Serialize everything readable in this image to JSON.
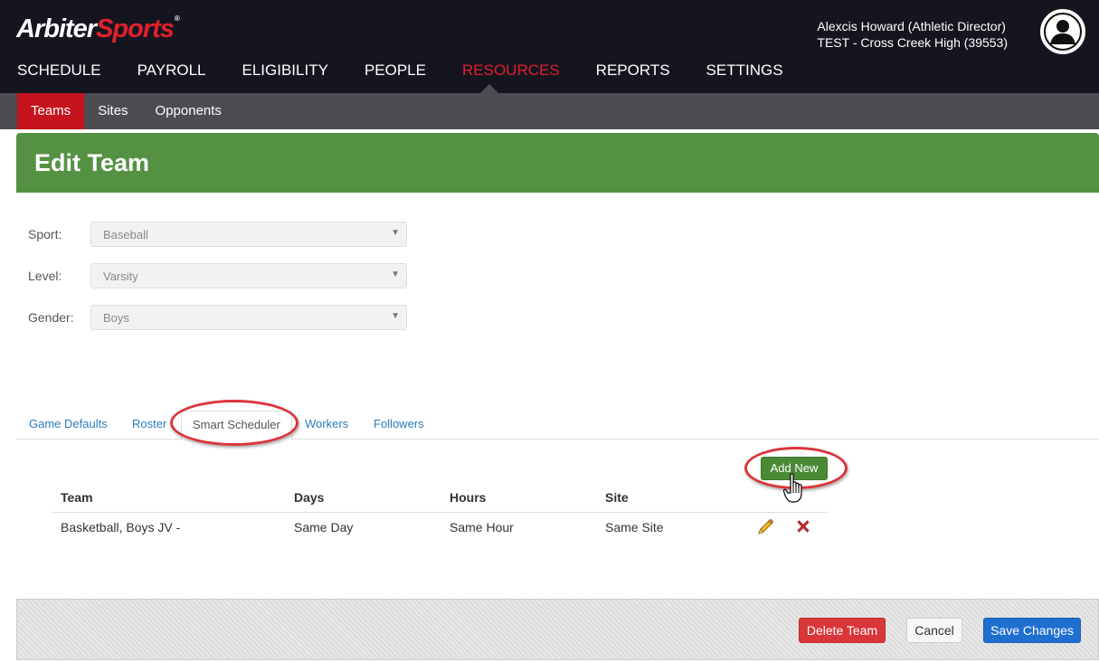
{
  "brand": {
    "part1": "Arbiter",
    "part2": "Sports"
  },
  "user": {
    "name": "Alexcis Howard (Athletic Director)",
    "org": "TEST - Cross Creek High (39553)"
  },
  "main_nav": [
    "SCHEDULE",
    "PAYROLL",
    "ELIGIBILITY",
    "PEOPLE",
    "RESOURCES",
    "REPORTS",
    "SETTINGS"
  ],
  "main_nav_active": "RESOURCES",
  "sub_nav": [
    "Teams",
    "Sites",
    "Opponents"
  ],
  "sub_nav_active": "Teams",
  "page_title": "Edit Team",
  "form": {
    "sport": {
      "label": "Sport:",
      "value": "Baseball"
    },
    "level": {
      "label": "Level:",
      "value": "Varsity"
    },
    "gender": {
      "label": "Gender:",
      "value": "Boys"
    }
  },
  "tabs": [
    "Game Defaults",
    "Roster",
    "Smart Scheduler",
    "Workers",
    "Followers"
  ],
  "tab_active": "Smart Scheduler",
  "add_new_label": "Add New",
  "table": {
    "headers": [
      "Team",
      "Days",
      "Hours",
      "Site"
    ],
    "rows": [
      [
        "Basketball, Boys JV -",
        "Same Day",
        "Same Hour",
        "Same Site"
      ]
    ]
  },
  "footer": {
    "delete_label": "Delete Team",
    "cancel_label": "Cancel",
    "save_label": "Save Changes"
  },
  "colors": {
    "topbar": "#15151f",
    "accent_red": "#e0202c",
    "title_green": "#559143",
    "save_blue": "#1f6fd1"
  },
  "icons": {
    "edit": "pencil-icon",
    "delete": "x-icon",
    "avatar": "user-silhouette-icon"
  }
}
